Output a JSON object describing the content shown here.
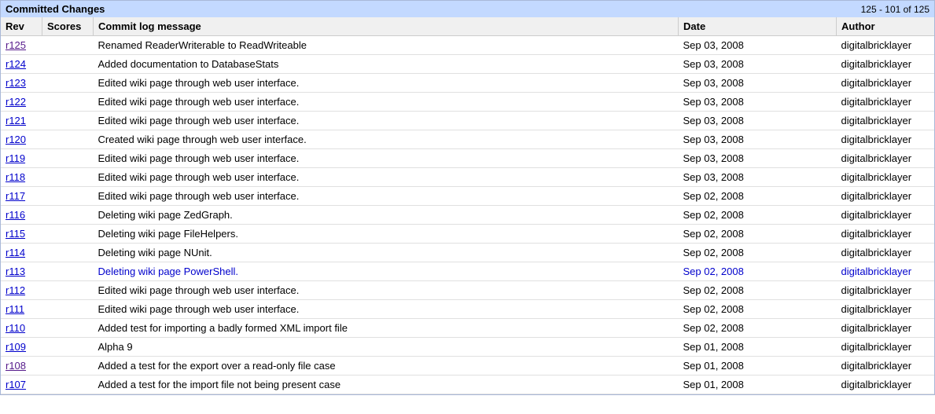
{
  "panel": {
    "title": "Committed Changes",
    "range": "125 - 101 of 125"
  },
  "columns": {
    "rev": "Rev",
    "scores": "Scores",
    "msg": "Commit log message",
    "date": "Date",
    "author": "Author"
  },
  "rows": [
    {
      "rev": "r125",
      "visited": true,
      "selected": false,
      "scores": "",
      "msg": "Renamed ReaderWriterable to ReadWriteable",
      "date": "Sep 03, 2008",
      "author": "digitalbricklayer"
    },
    {
      "rev": "r124",
      "visited": false,
      "selected": false,
      "scores": "",
      "msg": "Added documentation to DatabaseStats",
      "date": "Sep 03, 2008",
      "author": "digitalbricklayer"
    },
    {
      "rev": "r123",
      "visited": false,
      "selected": false,
      "scores": "",
      "msg": "Edited wiki page through web user interface.",
      "date": "Sep 03, 2008",
      "author": "digitalbricklayer"
    },
    {
      "rev": "r122",
      "visited": false,
      "selected": false,
      "scores": "",
      "msg": "Edited wiki page through web user interface.",
      "date": "Sep 03, 2008",
      "author": "digitalbricklayer"
    },
    {
      "rev": "r121",
      "visited": false,
      "selected": false,
      "scores": "",
      "msg": "Edited wiki page through web user interface.",
      "date": "Sep 03, 2008",
      "author": "digitalbricklayer"
    },
    {
      "rev": "r120",
      "visited": false,
      "selected": false,
      "scores": "",
      "msg": "Created wiki page through web user interface.",
      "date": "Sep 03, 2008",
      "author": "digitalbricklayer"
    },
    {
      "rev": "r119",
      "visited": false,
      "selected": false,
      "scores": "",
      "msg": "Edited wiki page through web user interface.",
      "date": "Sep 03, 2008",
      "author": "digitalbricklayer"
    },
    {
      "rev": "r118",
      "visited": false,
      "selected": false,
      "scores": "",
      "msg": "Edited wiki page through web user interface.",
      "date": "Sep 03, 2008",
      "author": "digitalbricklayer"
    },
    {
      "rev": "r117",
      "visited": false,
      "selected": false,
      "scores": "",
      "msg": "Edited wiki page through web user interface.",
      "date": "Sep 02, 2008",
      "author": "digitalbricklayer"
    },
    {
      "rev": "r116",
      "visited": false,
      "selected": false,
      "scores": "",
      "msg": "Deleting wiki page ZedGraph.",
      "date": "Sep 02, 2008",
      "author": "digitalbricklayer"
    },
    {
      "rev": "r115",
      "visited": false,
      "selected": false,
      "scores": "",
      "msg": "Deleting wiki page FileHelpers.",
      "date": "Sep 02, 2008",
      "author": "digitalbricklayer"
    },
    {
      "rev": "r114",
      "visited": false,
      "selected": false,
      "scores": "",
      "msg": "Deleting wiki page NUnit.",
      "date": "Sep 02, 2008",
      "author": "digitalbricklayer"
    },
    {
      "rev": "r113",
      "visited": false,
      "selected": true,
      "scores": "",
      "msg": "Deleting wiki page PowerShell.",
      "date": "Sep 02, 2008",
      "author": "digitalbricklayer"
    },
    {
      "rev": "r112",
      "visited": false,
      "selected": false,
      "scores": "",
      "msg": "Edited wiki page through web user interface.",
      "date": "Sep 02, 2008",
      "author": "digitalbricklayer"
    },
    {
      "rev": "r111",
      "visited": false,
      "selected": false,
      "scores": "",
      "msg": "Edited wiki page through web user interface.",
      "date": "Sep 02, 2008",
      "author": "digitalbricklayer"
    },
    {
      "rev": "r110",
      "visited": false,
      "selected": false,
      "scores": "",
      "msg": "Added test for importing a badly formed XML import file",
      "date": "Sep 02, 2008",
      "author": "digitalbricklayer"
    },
    {
      "rev": "r109",
      "visited": false,
      "selected": false,
      "scores": "",
      "msg": "Alpha 9",
      "date": "Sep 01, 2008",
      "author": "digitalbricklayer"
    },
    {
      "rev": "r108",
      "visited": true,
      "selected": false,
      "scores": "",
      "msg": "Added a test for the export over a read-only file case",
      "date": "Sep 01, 2008",
      "author": "digitalbricklayer"
    },
    {
      "rev": "r107",
      "visited": false,
      "selected": false,
      "scores": "",
      "msg": "Added a test for the import file not being present case",
      "date": "Sep 01, 2008",
      "author": "digitalbricklayer"
    }
  ]
}
